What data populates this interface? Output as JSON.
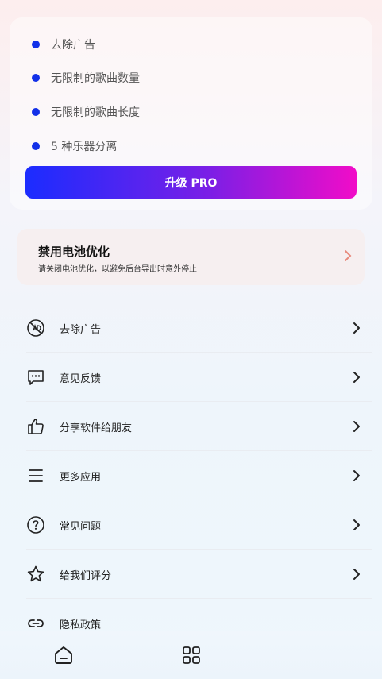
{
  "pro": {
    "features": [
      "去除广告",
      "无限制的歌曲数量",
      "无限制的歌曲长度",
      "5 种乐器分离"
    ],
    "upgrade_label": "升级 PRO"
  },
  "battery": {
    "title": "禁用电池优化",
    "subtitle": "请关闭电池优化，以避免后台导出时意外停止"
  },
  "menu": [
    {
      "label": "去除广告",
      "icon": "no-ads-icon"
    },
    {
      "label": "意见反馈",
      "icon": "feedback-icon"
    },
    {
      "label": "分享软件给朋友",
      "icon": "thumbs-up-icon"
    },
    {
      "label": "更多应用",
      "icon": "menu-lines-icon"
    },
    {
      "label": "常见问题",
      "icon": "question-icon"
    },
    {
      "label": "给我们评分",
      "icon": "star-icon"
    },
    {
      "label": "隐私政策",
      "icon": "link-icon"
    }
  ],
  "colors": {
    "accent_blue": "#1230e8",
    "gradient_start": "#1b2cff",
    "gradient_end": "#f10cc8"
  }
}
